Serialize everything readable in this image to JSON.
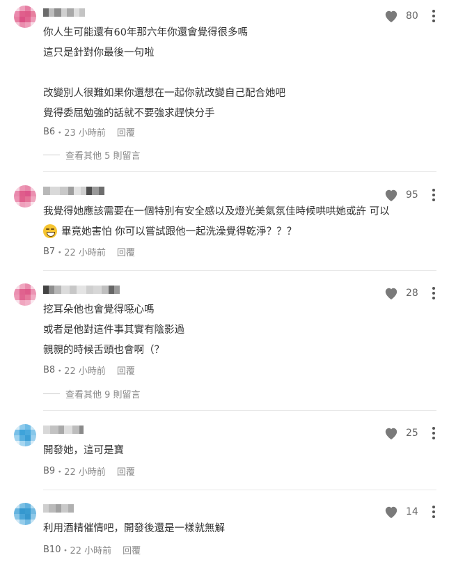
{
  "icons": {
    "like": "heart-icon",
    "more": "more-vertical-icon",
    "emoji": "grinning-face-emoji"
  },
  "colors": {
    "avatar_pink": "#e36a94",
    "avatar_blue": "#4aa7d8",
    "meta_text": "#888888",
    "body_text": "#333333"
  },
  "comments": [
    {
      "likes": "80",
      "lines": [
        "你人生可能還有60年那六年你還會覺得很多嗎",
        "這只是針對你最後一句啦",
        "",
        "改變別人很難如果你還想在一起你就改變自己配合她吧",
        "覺得委屈勉強的話就不要強求趕快分手"
      ],
      "floor": "B6",
      "time": "23 小時前",
      "reply": "回覆",
      "more_replies": "查看其他 5 則留言"
    },
    {
      "likes": "95",
      "lines": [
        "我覺得她應該需要在一個特別有安全感以及燈光美氣氛佳時候哄哄她或許 可以",
        "畢竟她害怕 你可以嘗試跟他一起洗澡覺得乾淨？？？"
      ],
      "floor": "B7",
      "time": "22 小時前",
      "reply": "回覆"
    },
    {
      "likes": "28",
      "lines": [
        "挖耳朵他也會覺得噁心嗎",
        "或者是他對這件事其實有陰影過",
        "親親的時候舌頭也會啊（？"
      ],
      "floor": "B8",
      "time": "22 小時前",
      "reply": "回覆",
      "more_replies": "查看其他 9 則留言"
    },
    {
      "likes": "25",
      "lines": [
        "開發她，這可是寶"
      ],
      "floor": "B9",
      "time": "22 小時前",
      "reply": "回覆"
    },
    {
      "likes": "14",
      "lines": [
        "利用酒精催情吧，開發後還是一樣就無解"
      ],
      "floor": "B10",
      "time": "22 小時前",
      "reply": "回覆"
    }
  ],
  "meta_separator": "・"
}
